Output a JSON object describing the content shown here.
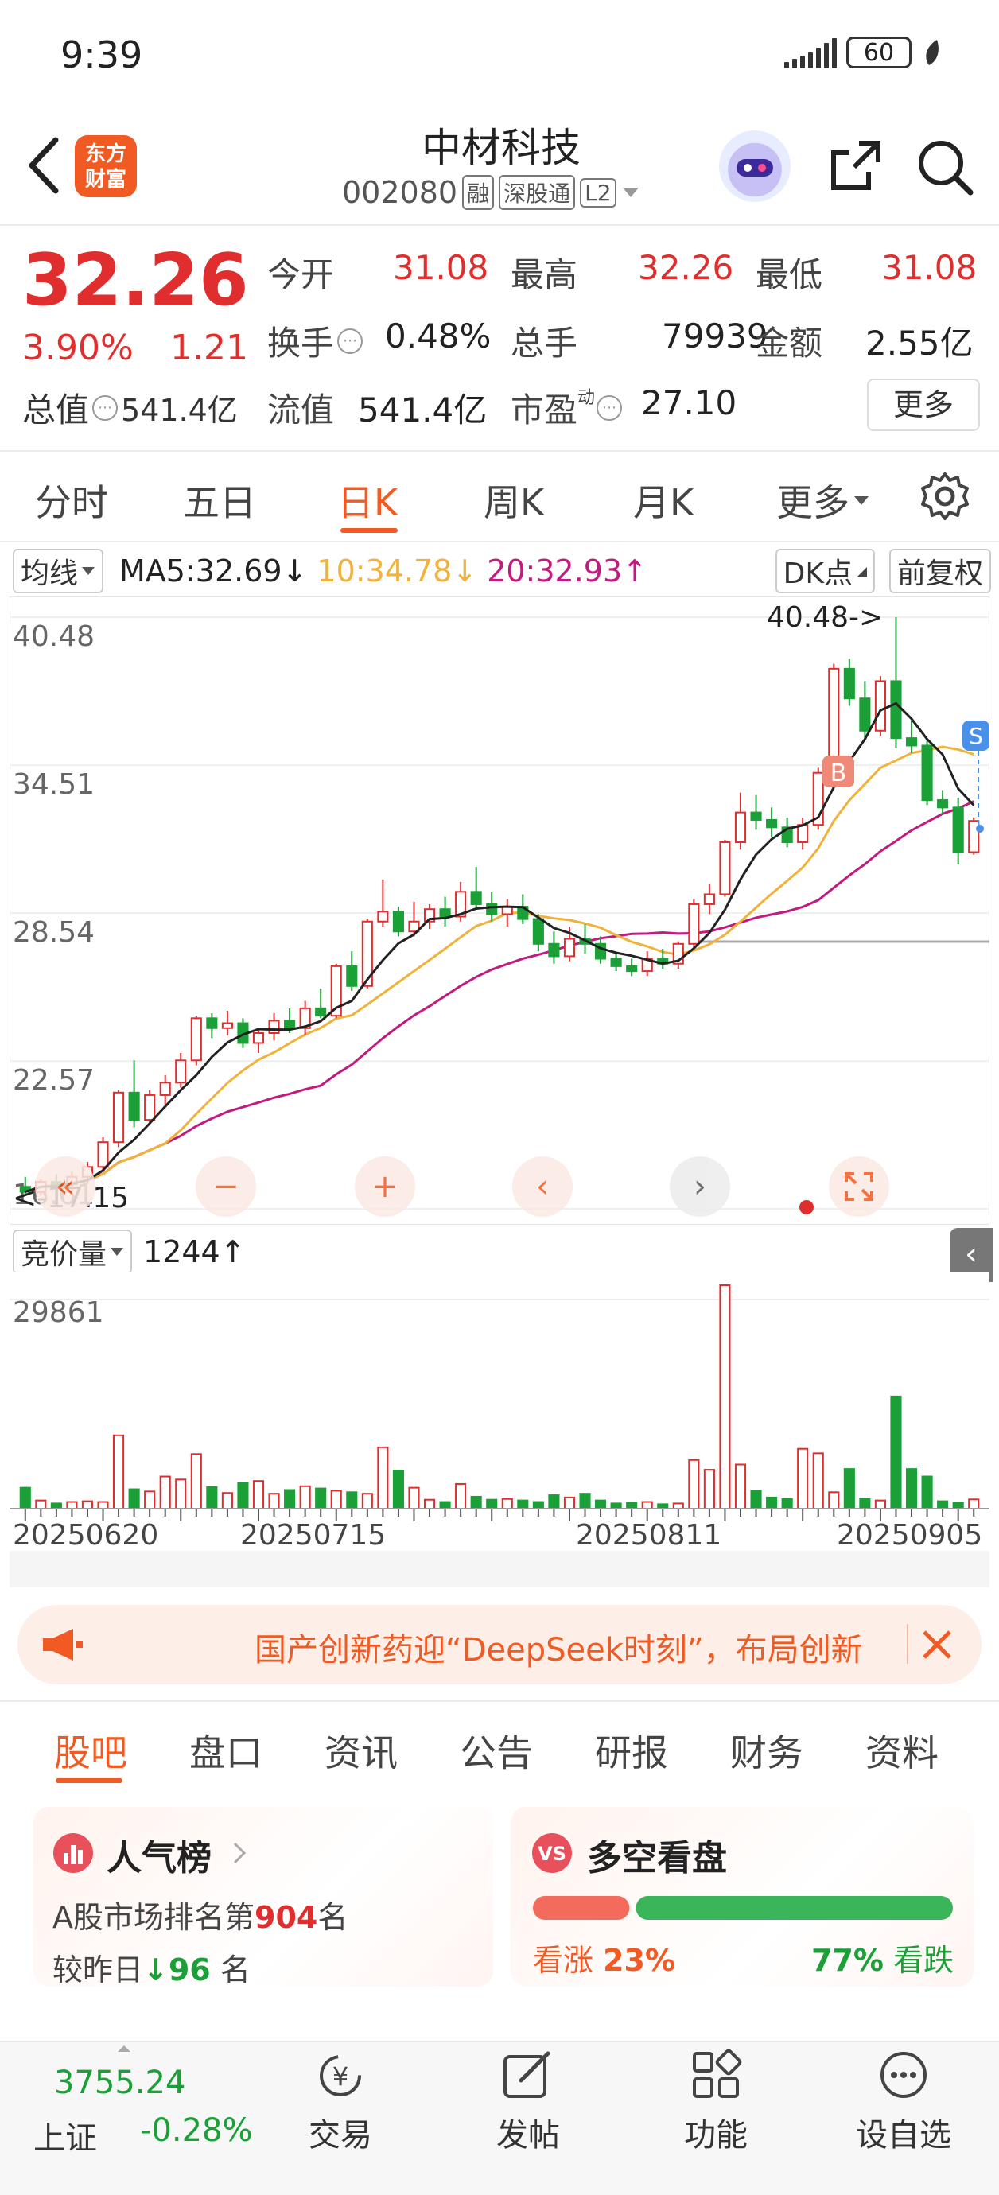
{
  "status_bar": {
    "time": "9:39",
    "battery": "60"
  },
  "header": {
    "logo_line1": "东方",
    "logo_line2": "财富",
    "stock_name": "中材科技",
    "stock_code": "002080",
    "tags": [
      "融",
      "深股通",
      "L2"
    ]
  },
  "quote": {
    "last_price": "32.26",
    "pct_change": "3.90%",
    "abs_change": "1.21",
    "total_value_label": "总值",
    "total_value": "541.4亿",
    "fields": [
      {
        "label": "今开",
        "value": "31.08",
        "color": "red"
      },
      {
        "label": "最高",
        "value": "32.26",
        "color": "red"
      },
      {
        "label": "最低",
        "value": "31.08",
        "color": "red"
      },
      {
        "label": "换手",
        "value": "0.48%",
        "color": "dark"
      },
      {
        "label": "总手",
        "value": "79939",
        "color": "dark"
      },
      {
        "label": "金额",
        "value": "2.55亿",
        "color": "dark"
      },
      {
        "label": "流值",
        "value": "541.4亿",
        "color": "dark"
      },
      {
        "label": "市盈",
        "value": "27.10",
        "color": "dark"
      }
    ],
    "pe_superscript": "动",
    "more_label": "更多"
  },
  "period_tabs": [
    "分时",
    "五日",
    "日K",
    "周K",
    "月K",
    "更多"
  ],
  "ma_row": {
    "selector": "均线",
    "ma5": "MA5:32.69",
    "ma10": "10:34.78",
    "ma20": "20:32.93",
    "dk_label": "DK点",
    "adjust_label": "前复权"
  },
  "chart_controls": {
    "high_marker": "40.48->",
    "low_marker": "<-17.15",
    "buy_marker": "B",
    "sell_marker": "S"
  },
  "volume": {
    "selector": "竞价量",
    "value": "1244",
    "max_label": "29861"
  },
  "news_banner": {
    "text": "国产创新药迎“DeepSeek时刻”，布局创新"
  },
  "content_tabs": [
    "股吧",
    "盘口",
    "资讯",
    "公告",
    "研报",
    "财务",
    "资料"
  ],
  "card_popularity": {
    "title": "人气榜",
    "line1_prefix": "A股市场排名第",
    "rank": "904",
    "line1_suffix": "名",
    "line2_prefix": "较昨日",
    "change": "96",
    "line2_suffix": " 名"
  },
  "card_bullbear": {
    "title": "多空看盘",
    "bull_label": "看涨",
    "bull_pct": "23%",
    "bear_pct": "77%",
    "bear_label": "看跌",
    "bull_fraction": 0.23
  },
  "bottom_nav": {
    "index_value": "3755.24",
    "index_name": "上证",
    "index_change": "-0.28%",
    "items": [
      "交易",
      "发帖",
      "功能",
      "设自选"
    ]
  },
  "colors": {
    "up": "#e02d2d",
    "down": "#1aa037",
    "accent": "#f15a22",
    "ma5": "#222222",
    "ma10": "#f0b23b",
    "ma20": "#c21a7e"
  },
  "chart_data": [
    {
      "type": "candlestick",
      "title": "",
      "ylim": [
        16.61,
        40.48
      ],
      "y_ticks": [
        "40.48",
        "34.51",
        "28.54",
        "22.57",
        "16.61"
      ],
      "x_ticks": [
        "20250620",
        "20250715",
        "20250811",
        "20250905"
      ],
      "high_value": 40.48,
      "low_value": 17.15,
      "grid": true,
      "series_ohlc": [
        [
          17.5,
          17.9,
          17.2,
          17.3
        ],
        [
          17.3,
          17.8,
          17.15,
          17.7
        ],
        [
          17.7,
          18.0,
          17.4,
          17.6
        ],
        [
          17.6,
          18.1,
          17.3,
          17.9
        ],
        [
          17.9,
          18.5,
          17.6,
          18.3
        ],
        [
          18.3,
          19.5,
          18.1,
          19.3
        ],
        [
          19.3,
          21.4,
          19.1,
          21.3
        ],
        [
          21.3,
          22.6,
          19.9,
          20.2
        ],
        [
          20.2,
          21.4,
          20.0,
          21.2
        ],
        [
          21.2,
          22.0,
          20.8,
          21.7
        ],
        [
          21.7,
          22.9,
          21.5,
          22.6
        ],
        [
          22.6,
          24.4,
          22.4,
          24.3
        ],
        [
          24.3,
          24.5,
          23.5,
          23.9
        ],
        [
          23.9,
          24.6,
          23.6,
          24.1
        ],
        [
          24.1,
          24.3,
          23.1,
          23.3
        ],
        [
          23.3,
          23.9,
          22.9,
          23.7
        ],
        [
          23.7,
          24.5,
          23.4,
          24.2
        ],
        [
          24.2,
          24.7,
          23.7,
          23.9
        ],
        [
          23.9,
          25.0,
          23.6,
          24.7
        ],
        [
          24.7,
          25.5,
          24.3,
          24.4
        ],
        [
          24.4,
          26.5,
          24.3,
          26.4
        ],
        [
          26.4,
          27.0,
          25.4,
          25.6
        ],
        [
          25.6,
          28.3,
          25.5,
          28.2
        ],
        [
          28.2,
          29.9,
          28.0,
          28.6
        ],
        [
          28.6,
          28.8,
          27.6,
          27.8
        ],
        [
          27.8,
          29.0,
          27.6,
          28.2
        ],
        [
          28.2,
          28.9,
          27.9,
          28.7
        ],
        [
          28.7,
          29.2,
          28.0,
          28.4
        ],
        [
          28.4,
          29.8,
          28.2,
          29.4
        ],
        [
          29.4,
          30.4,
          28.7,
          28.9
        ],
        [
          28.9,
          29.4,
          28.2,
          28.5
        ],
        [
          28.5,
          29.1,
          28.0,
          28.8
        ],
        [
          28.8,
          29.3,
          28.1,
          28.3
        ],
        [
          28.3,
          28.5,
          27.0,
          27.3
        ],
        [
          27.3,
          27.8,
          26.5,
          26.8
        ],
        [
          26.8,
          28.0,
          26.6,
          27.5
        ],
        [
          27.5,
          28.1,
          26.9,
          27.3
        ],
        [
          27.3,
          27.6,
          26.5,
          26.7
        ],
        [
          26.7,
          26.9,
          26.2,
          26.4
        ],
        [
          26.4,
          26.7,
          26.0,
          26.2
        ],
        [
          26.2,
          27.0,
          26.0,
          26.7
        ],
        [
          26.7,
          27.1,
          26.3,
          26.5
        ],
        [
          26.5,
          27.4,
          26.3,
          27.3
        ],
        [
          27.3,
          29.1,
          27.1,
          28.9
        ],
        [
          28.9,
          29.7,
          28.5,
          29.3
        ],
        [
          29.3,
          31.5,
          29.2,
          31.4
        ],
        [
          31.4,
          33.4,
          31.1,
          32.6
        ],
        [
          32.6,
          33.3,
          31.9,
          32.3
        ],
        [
          32.3,
          32.8,
          31.6,
          32.0
        ],
        [
          32.0,
          32.4,
          31.2,
          31.4
        ],
        [
          31.4,
          32.4,
          31.1,
          32.1
        ],
        [
          32.1,
          34.4,
          31.9,
          34.2
        ],
        [
          34.2,
          38.6,
          34.1,
          38.4
        ],
        [
          38.4,
          38.8,
          36.9,
          37.2
        ],
        [
          37.2,
          37.9,
          35.6,
          35.9
        ],
        [
          35.9,
          38.1,
          35.7,
          37.9
        ],
        [
          37.9,
          40.48,
          35.2,
          35.6
        ],
        [
          35.6,
          36.3,
          35.0,
          35.3
        ],
        [
          35.3,
          35.6,
          32.9,
          33.1
        ],
        [
          33.1,
          33.5,
          32.5,
          32.8
        ],
        [
          32.8,
          33.2,
          30.5,
          31.0
        ],
        [
          31.0,
          32.4,
          30.9,
          32.26
        ]
      ]
    },
    {
      "type": "bar",
      "title": "竞价量",
      "ylim": [
        0,
        29861
      ],
      "values": [
        2800,
        1100,
        700,
        900,
        1000,
        900,
        9800,
        2600,
        2300,
        4300,
        3900,
        7300,
        2900,
        2100,
        3400,
        3700,
        2000,
        2500,
        3000,
        2700,
        2400,
        2200,
        2000,
        8200,
        5100,
        2800,
        1200,
        900,
        3300,
        1600,
        1200,
        1300,
        1100,
        900,
        1800,
        1500,
        2000,
        1100,
        700,
        800,
        900,
        600,
        700,
        6500,
        5200,
        29861,
        5900,
        2400,
        1500,
        1300,
        8000,
        7400,
        2200,
        5300,
        1300,
        1100,
        15000,
        5300,
        4300,
        1000,
        800,
        1244
      ]
    }
  ]
}
